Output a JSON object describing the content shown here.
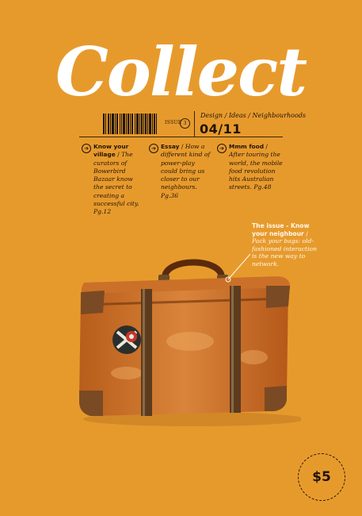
{
  "masthead": {
    "title": "Collect"
  },
  "issue": {
    "label": "ISSUE",
    "number": "3",
    "date": "04/11"
  },
  "tagline": "Design / Ideas / Neighbourhoods",
  "columns": [
    {
      "heading": "Know your village",
      "separator": " / ",
      "text": "The curators of Bowerbird Bazaar know the secret to creating a successful city.",
      "page": "Pg.12"
    },
    {
      "heading": "Essay",
      "separator": " / ",
      "text": "How a different kind of power-play could bring us closer to our neighbours.",
      "page": "Pg.36"
    },
    {
      "heading": "Mmm food",
      "separator": " / ",
      "text": "After touring the world, the mobile food revolution hits Australian streets.",
      "page": "Pg.48"
    }
  ],
  "callout": {
    "heading": "The issue - Know your neighbour",
    "separator": " / ",
    "text": "Pack your bags: old-fashioned interaction is the new way to network."
  },
  "price": "$5",
  "icons": {
    "arrow": "arrow-right-circle-icon",
    "barcode": "barcode-icon"
  },
  "colors": {
    "background": "#E79A2C",
    "text": "#1f140a",
    "masthead": "#ffffff",
    "suitcase": "#C8681E"
  }
}
